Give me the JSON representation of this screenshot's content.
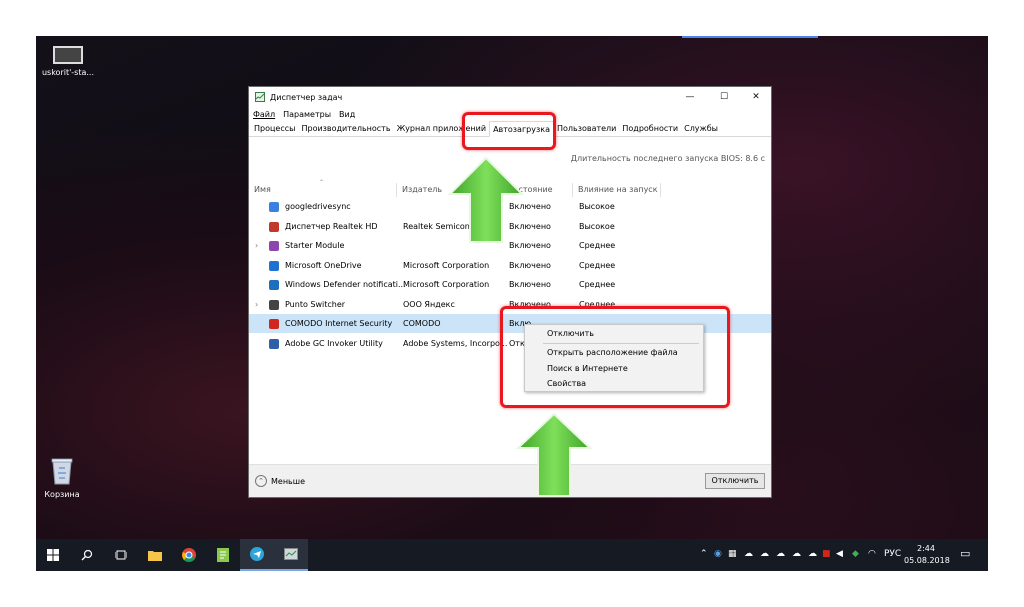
{
  "desktop": {
    "shortcut_label": "uskorit'-sta...",
    "recycle_bin_label": "Корзина"
  },
  "window": {
    "title": "Диспетчер задач",
    "minimize": "—",
    "maximize": "☐",
    "close": "✕"
  },
  "menu": [
    "Файл",
    "Параметры",
    "Вид"
  ],
  "tabs": [
    "Процессы",
    "Производительность",
    "Журнал приложений",
    "Автозагрузка",
    "Пользователи",
    "Подробности",
    "Службы"
  ],
  "selected_tab": "Автозагрузка",
  "bios_text": "Длительность последнего запуска BIOS: 8.6 с",
  "columns": {
    "name": "Имя",
    "publisher": "Издатель",
    "status": "Состояние",
    "impact": "Влияние на запуск"
  },
  "rows": [
    {
      "name": "googledrivesync",
      "publisher": "",
      "status": "Включено",
      "impact": "Высокое",
      "icon_color": "#3b82e0",
      "expand": false
    },
    {
      "name": "Диспетчер Realtek HD",
      "publisher": "Realtek Semicond",
      "status": "Включено",
      "impact": "Высокое",
      "icon_color": "#c0392b",
      "expand": false
    },
    {
      "name": "Starter Module",
      "publisher": "",
      "status": "Включено",
      "impact": "Среднее",
      "icon_color": "#8e44ad",
      "expand": true
    },
    {
      "name": "Microsoft OneDrive",
      "publisher": "Microsoft Corporation",
      "status": "Включено",
      "impact": "Среднее",
      "icon_color": "#1e73d2",
      "expand": false
    },
    {
      "name": "Windows Defender notificati...",
      "publisher": "Microsoft Corporation",
      "status": "Включено",
      "impact": "Среднее",
      "icon_color": "#1f6fbf",
      "expand": false
    },
    {
      "name": "Punto Switcher",
      "publisher": "ООО Яндекс",
      "status": "Включено",
      "impact": "Среднее",
      "icon_color": "#444444",
      "expand": true
    },
    {
      "name": "COMODO Internet Security",
      "publisher": "COMODO",
      "status": "Вклю",
      "impact": "",
      "icon_color": "#d0261e",
      "expand": false
    },
    {
      "name": "Adobe GC Invoker Utility",
      "publisher": "Adobe Systems, Incorpo...",
      "status": "Откл",
      "impact": "",
      "icon_color": "#2d5fa8",
      "expand": false
    }
  ],
  "context_menu": [
    "Отключить",
    "Открыть расположение файла",
    "Поиск в Интернете",
    "Свойства"
  ],
  "footer": {
    "less_label": "Меньше",
    "disable_button": "Отключить"
  },
  "taskbar": {
    "lang": "РУС",
    "time": "2:44",
    "date": "05.08.2018"
  },
  "colors": {
    "highlight_red": "#e8181e",
    "arrow_green": "#5ec63a",
    "selection_blue": "#cce4f7"
  }
}
